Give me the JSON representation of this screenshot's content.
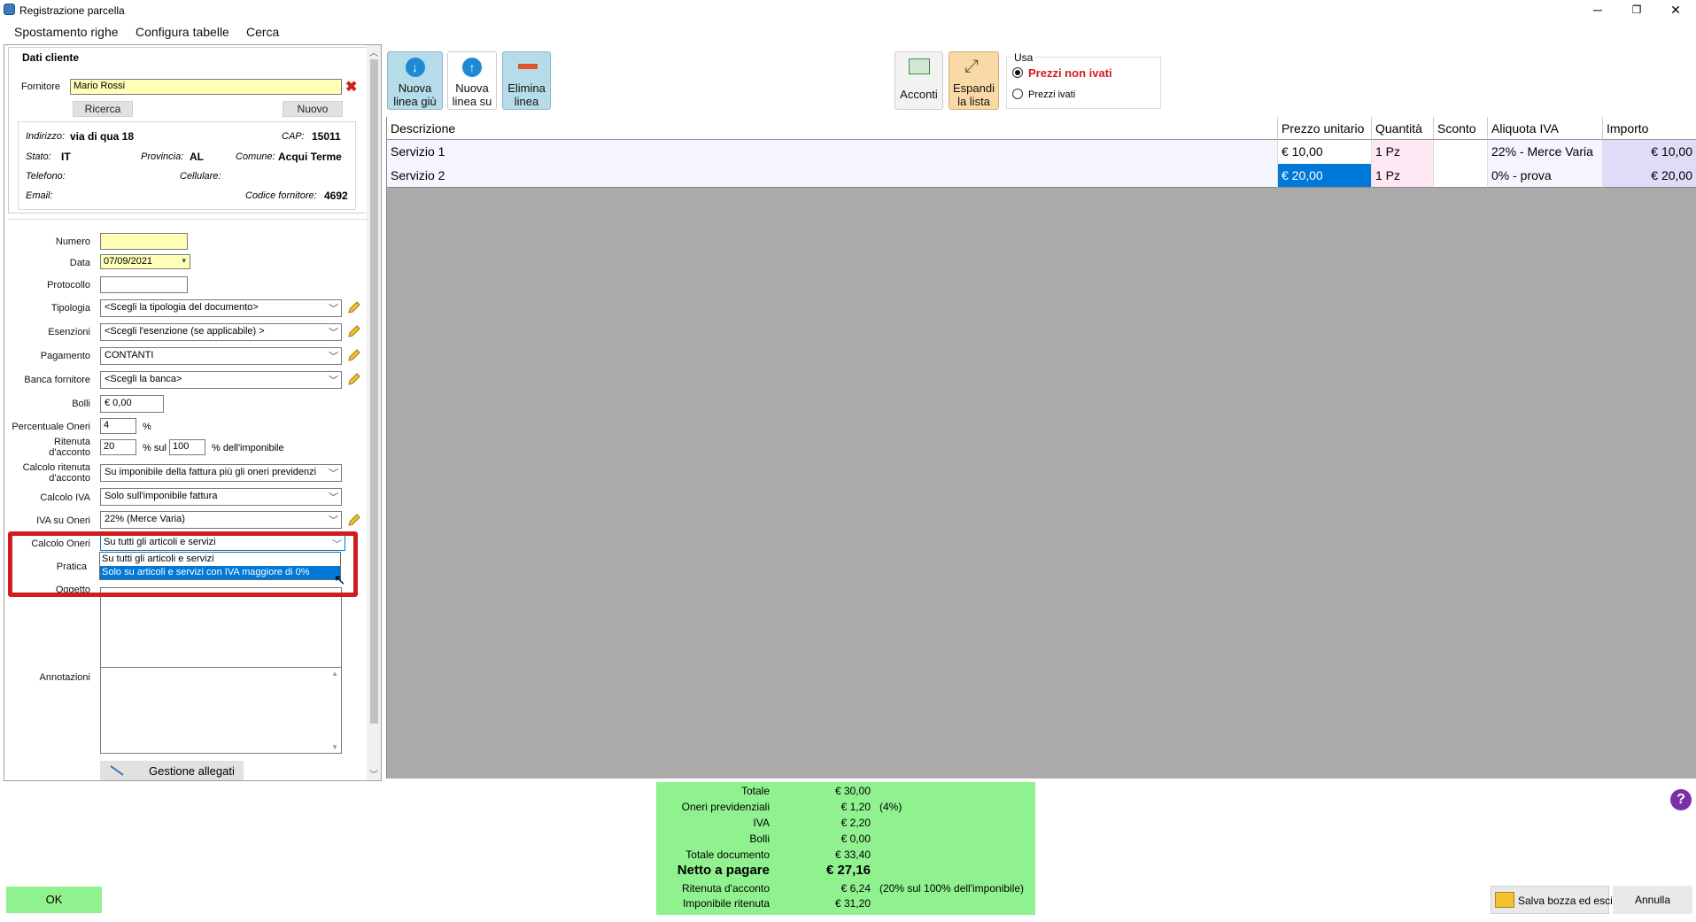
{
  "window": {
    "title": "Registrazione parcella",
    "minimize": "─",
    "restore": "❐",
    "close": "✕"
  },
  "menu": [
    "Spostamento righe",
    "Configura tabelle",
    "Cerca"
  ],
  "client": {
    "section": "Dati cliente",
    "fornitore_label": "Fornitore",
    "fornitore_value": "Mario Rossi",
    "ricerca": "Ricerca",
    "nuovo": "Nuovo",
    "indirizzo_label": "Indirizzo:",
    "indirizzo": "via di qua 18",
    "cap_label": "CAP:",
    "cap": "15011",
    "stato_label": "Stato:",
    "stato": "IT",
    "provincia_label": "Provincia:",
    "provincia": "AL",
    "comune_label": "Comune:",
    "comune": "Acqui Terme",
    "telefono_label": "Telefono:",
    "cellulare_label": "Cellulare:",
    "email_label": "Email:",
    "codice_label": "Codice fornitore:",
    "codice": "4692"
  },
  "form": {
    "numero_label": "Numero",
    "numero": "",
    "data_label": "Data",
    "data": "07/09/2021",
    "protocollo_label": "Protocollo",
    "protocollo": "",
    "tipologia_label": "Tipologia",
    "tipologia": "<Scegli la tipologia del documento>",
    "esenzioni_label": "Esenzioni",
    "esenzioni": "<Scegli l'esenzione (se applicabile) >",
    "pagamento_label": "Pagamento",
    "pagamento": "CONTANTI",
    "banca_label": "Banca fornitore",
    "banca": "<Scegli la banca>",
    "bolli_label": "Bolli",
    "bolli": "€ 0,00",
    "perconeri_label": "Percentuale Oneri",
    "perconeri": "4",
    "percent_sign": "%",
    "ritenuta_label1": "Ritenuta",
    "ritenuta_label2": "d'acconto",
    "ritenuta": "20",
    "sul_label": "% sul",
    "ritenuta_base": "100",
    "imponibile_label": "% dell'imponibile",
    "calcrit_label1": "Calcolo ritenuta",
    "calcrit_label2": "d'acconto",
    "calcrit": "Su imponibile della fattura più gli oneri previdenzi",
    "calciva_label": "Calcolo IVA",
    "calciva": "Solo sull'imponibile fattura",
    "ivaoneri_label": "IVA su Oneri",
    "ivaoneri": "22% (Merce Varia)",
    "calconeri_label": "Calcolo Oneri",
    "calconeri": "Su tutti gli articoli e servizi",
    "calconeri_options": [
      "Su tutti gli articoli e servizi",
      "Solo su articoli e servizi con IVA maggiore di 0%"
    ],
    "pratica_label": "Pratica",
    "oggetto_label": "Oggetto",
    "annotazioni_label": "Annotazioni",
    "allegati": "Gestione allegati"
  },
  "toolbar": {
    "nuova_giu": [
      "Nuova",
      "linea giù"
    ],
    "nuova_su": [
      "Nuova",
      "linea su"
    ],
    "elimina": [
      "Elimina",
      "linea"
    ],
    "acconti": "Acconti",
    "espandi": [
      "Espandi",
      "la lista"
    ],
    "usa_label": "Usa",
    "prezzi_non_ivati": "Prezzi non ivati",
    "prezzi_ivati": "Prezzi ivati"
  },
  "grid": {
    "headers": [
      "Descrizione",
      "Prezzo unitario",
      "Quantità",
      "Sconto",
      "Aliquota IVA",
      "Importo"
    ],
    "rows": [
      [
        "Servizio 1",
        "€ 10,00",
        "1 Pz",
        "",
        "22% - Merce Varia",
        "€ 10,00"
      ],
      [
        "Servizio 2",
        "€ 20,00",
        "1 Pz",
        "",
        "0% - prova",
        "€ 20,00"
      ]
    ]
  },
  "totals": {
    "totale_label": "Totale",
    "totale": "€ 30,00",
    "oneri_label": "Oneri previdenziali",
    "oneri": "€ 1,20",
    "oneri_note": "(4%)",
    "iva_label": "IVA",
    "iva": "€ 2,20",
    "bolli_label": "Bolli",
    "bolli": "€ 0,00",
    "totdoc_label": "Totale documento",
    "totdoc": "€ 33,40",
    "netto_label": "Netto a pagare",
    "netto": "€ 27,16",
    "rit_label": "Ritenuta d'acconto",
    "rit": "€ 6,24",
    "rit_note": "(20% sul 100% dell'imponibile)",
    "impon_label": "Imponibile ritenuta",
    "impon": "€ 31,20"
  },
  "footer": {
    "ok": "OK",
    "salva": "Salva bozza ed esci",
    "annulla": "Annulla",
    "help": "?"
  },
  "colors": {
    "accent_blue": "#0078d7",
    "green_panel": "#8ff28f",
    "highlight_red": "#d01e1e",
    "toolbar_blue": "#b6dbe9"
  }
}
